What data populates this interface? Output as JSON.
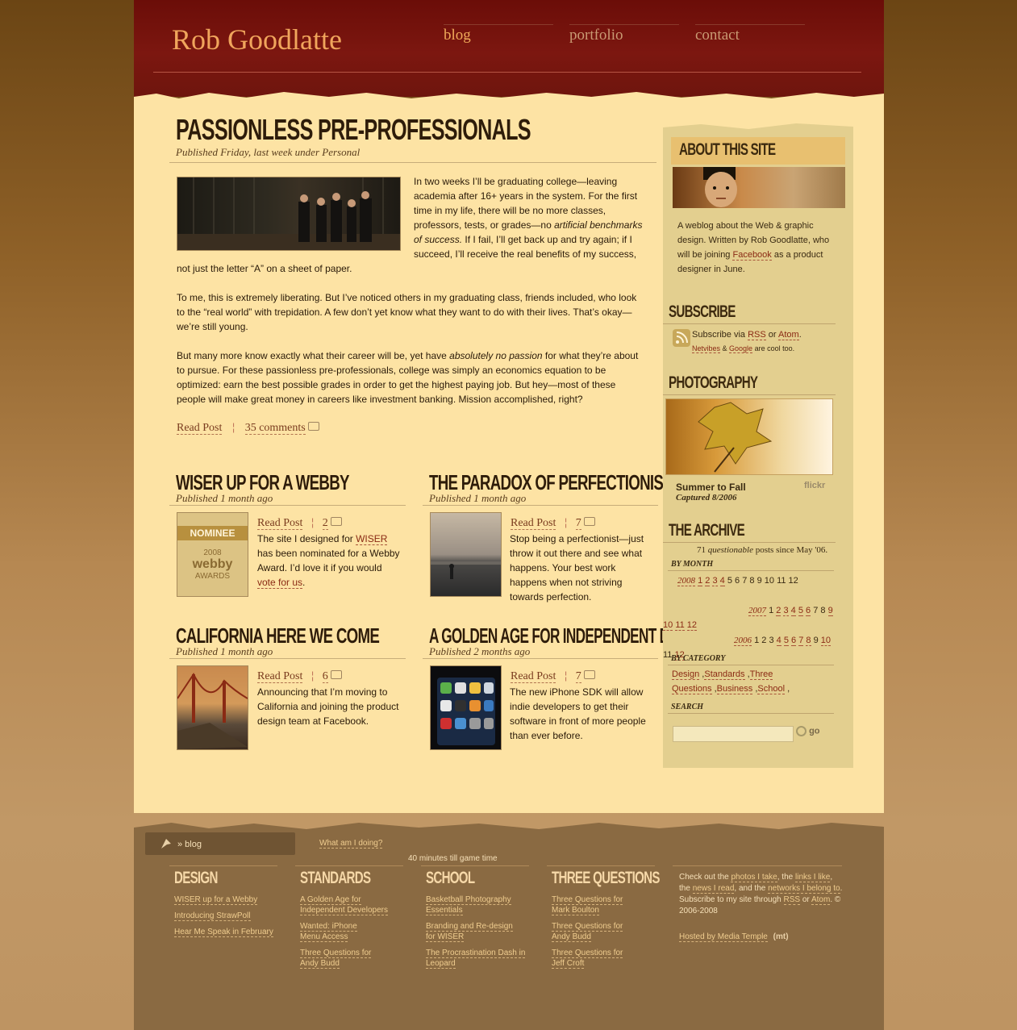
{
  "site": {
    "title": "Rob Goodlatte"
  },
  "nav": {
    "items": [
      "blog",
      "portfolio",
      "contact"
    ]
  },
  "featured": {
    "title": "Passionless Pre-Professionals",
    "meta": "Published Friday, last week under Personal",
    "p1a": "In two weeks I’ll be graduating college—leaving academia after 16+ years in the system. For the first time in my life, there will be no more classes, professors, tests, or grades—no ",
    "p1em": "artificial benchmarks of success.",
    "p1b": " If I fail, I’ll get back up and try again; if I succeed, I’ll receive the real benefits of my success, not just the letter “A” on a sheet of paper.",
    "p2": "To me, this is extremely liberating. But I’ve noticed others in my graduating class, friends included, who look to the “real world” with trepidation. A few don’t yet know what they want to do with their lives. That’s okay—we’re still young.",
    "p3a": "But many more know exactly what their career will be, yet have ",
    "p3em": "absolutely no passion",
    "p3b": " for what they’re about to pursue. For these passionless pre-professionals, college was simply an economics equation to be optimized: earn the best possible grades in order to get the highest paying job. But hey—most of these people will make great money in careers like investment banking. Mission accomplished, right?",
    "read_post": "Read Post",
    "comments": "35 comments"
  },
  "posts": [
    {
      "title": "Wiser up for a Webby",
      "meta": "Published 1 month ago",
      "read": "Read Post",
      "count": "2",
      "t1": "The site I designed for ",
      "l1": "WISER",
      "t2": " has been nominated for a Webby Award. I’d love it if you would ",
      "l2": "vote for us",
      "t3": ".",
      "badge_top": "NOMINEE",
      "badge_year": "2008",
      "badge_name": "webby",
      "badge_sub": "AWARDS"
    },
    {
      "title": "The Paradox of Perfectionism",
      "meta": "Published 1 month ago",
      "read": "Read Post",
      "count": "7",
      "text": "Stop being a perfectionist—just throw it out there and see what happens. Your best work happens when not striving towards perfection."
    },
    {
      "title": "California here we come",
      "meta": "Published 1 month ago",
      "read": "Read Post",
      "count": "6",
      "text": "Announcing that I’m moving to California and joining the product design team at Facebook."
    },
    {
      "title": "A Golden Age for Independent Developers",
      "meta": "Published 2 months ago",
      "read": "Read Post",
      "count": "7",
      "text": "The new iPhone SDK will allow indie developers to get their software in front of more people than ever before."
    }
  ],
  "sidebar": {
    "about_title": "About This Site",
    "about_a": "A weblog about the Web & graphic design. Written by Rob Goodlatte, who will be joining ",
    "about_link": "Facebook",
    "about_b": " as a product designer in June.",
    "subscribe_title": "Subscribe",
    "sub_a": "Subscribe via ",
    "sub_rss": "RSS",
    "sub_or": " or ",
    "sub_atom": "Atom",
    "sub_dot": ".",
    "sub_netvibes": "Netvibes",
    "sub_amp": " & ",
    "sub_google": "Google",
    "sub_cool": " are cool too.",
    "photo_title": "Photography",
    "photo_caption": "Summer to Fall",
    "photo_date": "Captured 8/2006",
    "flickr": "flickr",
    "archive_title": "The Archive",
    "archive_count_a": "71 ",
    "archive_count_em": "questionable",
    "archive_count_b": " posts since May '06.",
    "by_month": "By Month",
    "by_category": "By Category",
    "search_label": "Search",
    "search_button": "go",
    "categories": [
      "Design",
      "Standards",
      "Three Questions",
      "Business",
      "School"
    ],
    "archive_rows": [
      {
        "year": "2008",
        "months": [
          "1",
          "2",
          "3",
          "4",
          "5",
          "6",
          "7",
          "8",
          "9",
          "10",
          "11",
          "12"
        ],
        "linked": [
          1,
          2,
          3,
          4
        ]
      },
      {
        "year": "2007",
        "months": [
          "1",
          "2",
          "3",
          "4",
          "5",
          "6",
          "7",
          "8",
          "9",
          "10",
          "11",
          "12"
        ],
        "linked": [
          2,
          3,
          4,
          5,
          6,
          9,
          10,
          11,
          12
        ]
      },
      {
        "year": "2006",
        "months": [
          "1",
          "2",
          "3",
          "4",
          "5",
          "6",
          "7",
          "8",
          "9",
          "10",
          "11",
          "12"
        ],
        "linked": [
          4,
          5,
          6,
          7,
          8,
          10,
          12
        ]
      }
    ]
  },
  "footer": {
    "crumb": "» blog",
    "doing_label": "What am I doing?",
    "doing_text": "40 minutes till game time",
    "columns": [
      {
        "title": "Design",
        "items": [
          "WISER up for a Webby",
          "Introducing StrawPoll",
          "Hear Me Speak in February"
        ]
      },
      {
        "title": "Standards",
        "items": [
          "A Golden Age for Independent Developers",
          "Wanted: iPhone Menu Access",
          "Three Questions for Andy Budd"
        ]
      },
      {
        "title": "School",
        "items": [
          "Basketball Photography Essentials",
          "Branding and Re-design for WISER",
          "The Procrastination Dash in Leopard"
        ]
      },
      {
        "title": "Three Questions",
        "items": [
          "Three Questions for Mark Boulton",
          "Three Questions for Andy Budd",
          "Three Questions for Jeff Croft"
        ]
      }
    ],
    "about_1": "Check out the ",
    "about_photos": "photos I take",
    "about_2": ", the ",
    "about_links": "links I like",
    "about_3": ", the ",
    "about_news": "news I read",
    "about_4": ", and the ",
    "about_networks": "networks I belong to",
    "about_5": ". Subscribe to my site through ",
    "about_rss": "RSS",
    "about_6": " or ",
    "about_atom": "Atom",
    "about_7": ". © 2006-2008",
    "hosted": "Hosted by Media Temple",
    "hosted_logo": "(mt)"
  }
}
